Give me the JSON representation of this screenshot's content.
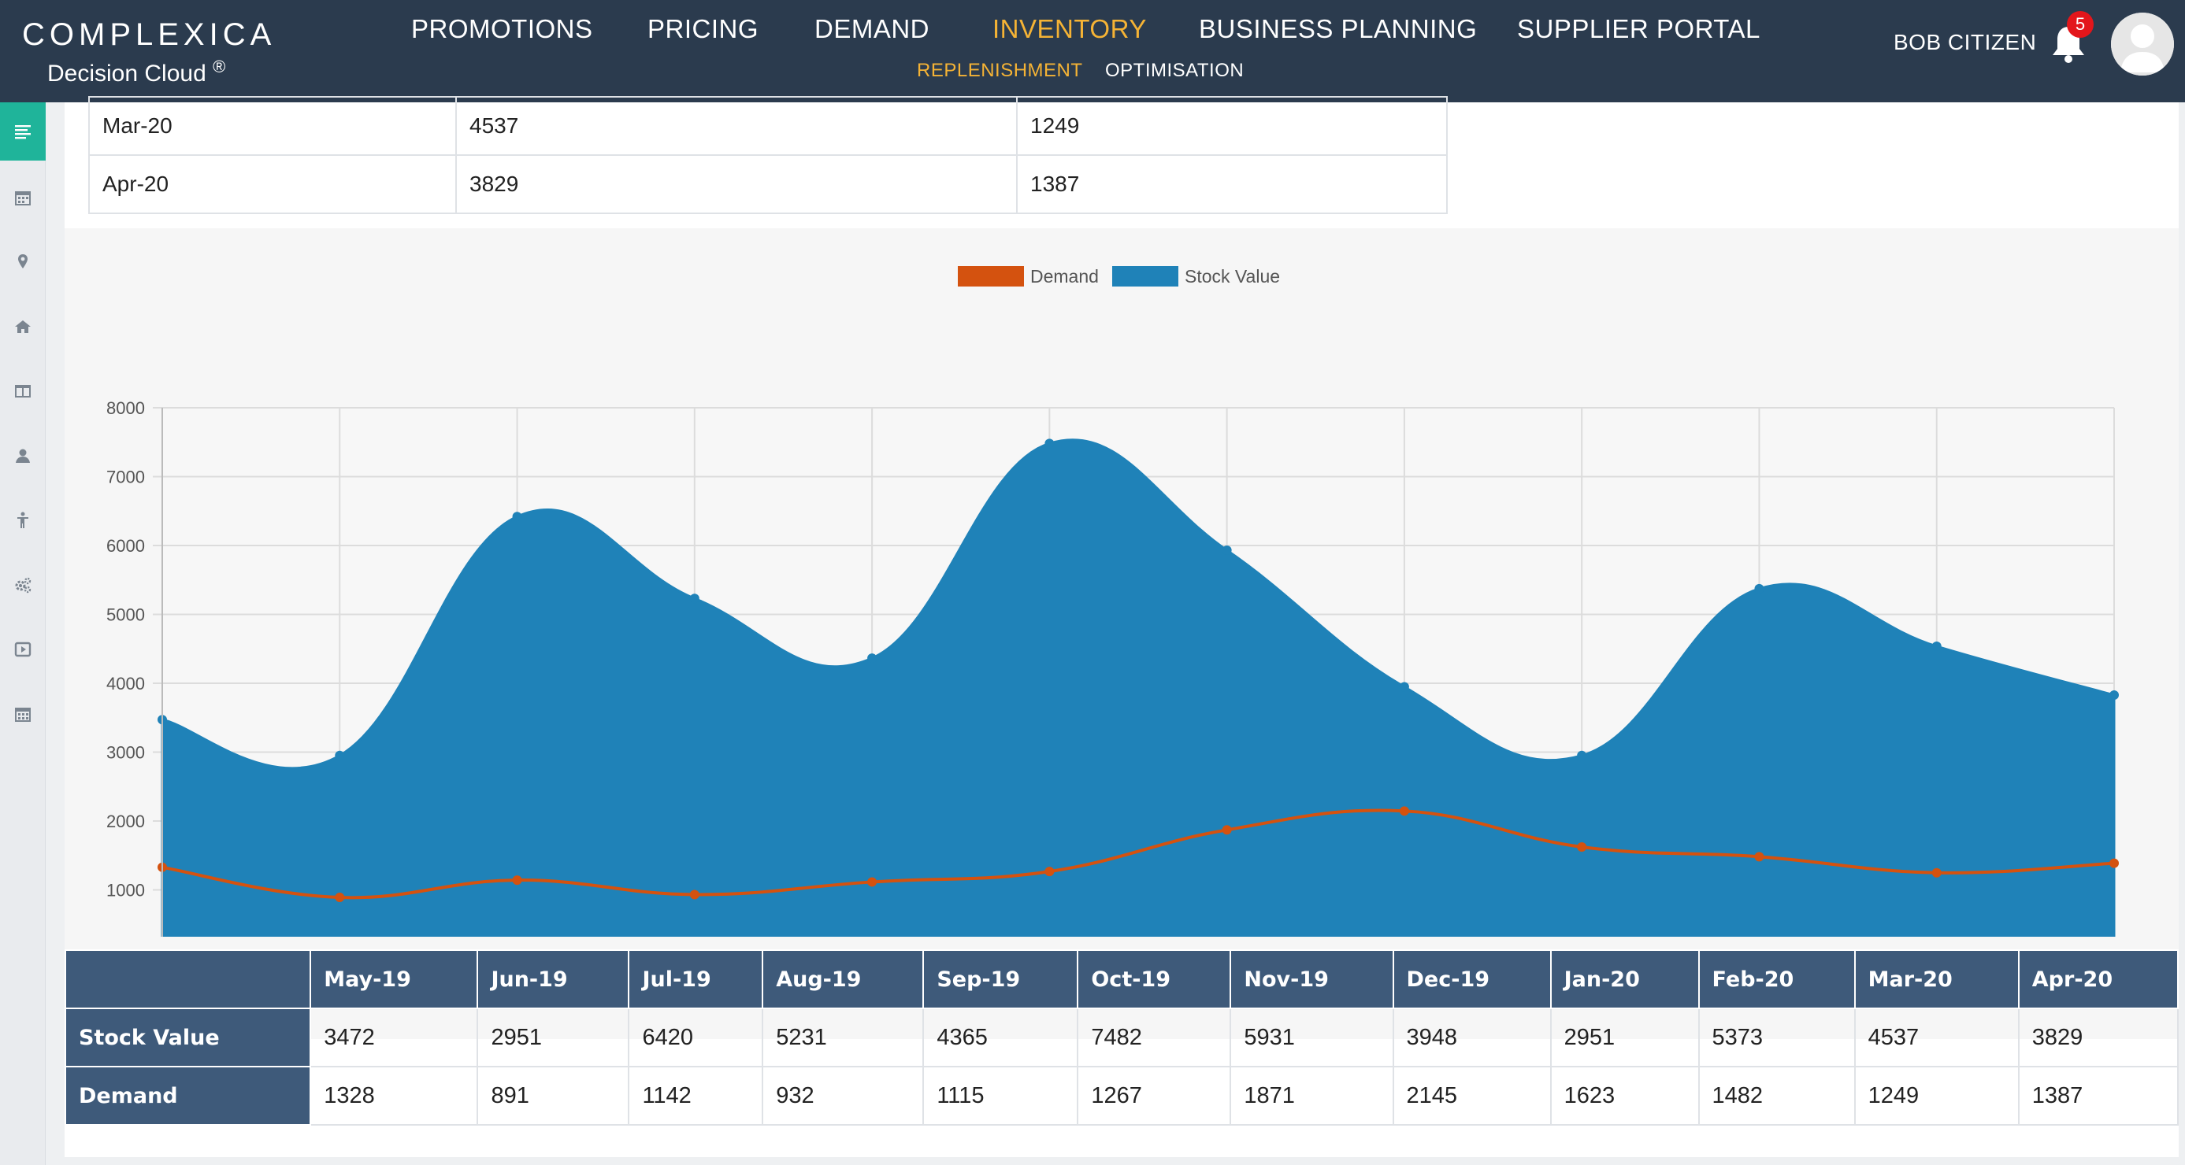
{
  "app": {
    "brand": "COMPLEXICA",
    "subtitle": "Decision Cloud",
    "registered": "®"
  },
  "nav": {
    "items": [
      {
        "label": "PROMOTIONS",
        "active": false
      },
      {
        "label": "PRICING",
        "active": false
      },
      {
        "label": "DEMAND",
        "active": false
      },
      {
        "label": "INVENTORY",
        "active": true
      },
      {
        "label": "BUSINESS PLANNING",
        "active": false
      },
      {
        "label": "SUPPLIER PORTAL",
        "active": false
      }
    ],
    "subitems": [
      {
        "label": "REPLENISHMENT",
        "active": true
      },
      {
        "label": "OPTIMISATION",
        "active": false
      }
    ]
  },
  "user": {
    "name": "BOB CITIZEN",
    "notification_count": "5"
  },
  "sidebar": {
    "items": [
      {
        "icon": "list-icon",
        "active": true
      },
      {
        "icon": "calendar-icon",
        "active": false
      },
      {
        "icon": "map-pin-icon",
        "active": false
      },
      {
        "icon": "home-icon",
        "active": false
      },
      {
        "icon": "columns-icon",
        "active": false
      },
      {
        "icon": "user-icon",
        "active": false
      },
      {
        "icon": "person-icon",
        "active": false
      },
      {
        "icon": "cogs-icon",
        "active": false
      },
      {
        "icon": "play-icon",
        "active": false
      },
      {
        "icon": "calendar-alt-icon",
        "active": false
      }
    ]
  },
  "monthly_table": {
    "rows": [
      [
        "Mar-20",
        "4537",
        "1249"
      ],
      [
        "Apr-20",
        "3829",
        "1387"
      ]
    ]
  },
  "colors": {
    "demand": "#d4520f",
    "stock_value": "#1f82b8",
    "header_bg": "#2b3b4e",
    "accent": "#f5b335",
    "sidebar_active": "#1fb49a",
    "table_header": "#3e5a7a"
  },
  "chart_data": {
    "type": "area",
    "categories": [
      "May-19",
      "Jun-19",
      "Jul-19",
      "Aug-19",
      "Sep-19",
      "Oct-19",
      "Nov-19",
      "Dec-19",
      "Jan-20",
      "Feb-20",
      "Mar-20",
      "Apr-20"
    ],
    "series": [
      {
        "name": "Demand",
        "type": "line",
        "values": [
          1328,
          891,
          1142,
          932,
          1115,
          1267,
          1871,
          2145,
          1623,
          1482,
          1249,
          1387
        ]
      },
      {
        "name": "Stock Value",
        "type": "area",
        "values": [
          3472,
          2951,
          6420,
          5231,
          4365,
          7482,
          5931,
          3948,
          2951,
          5373,
          4537,
          3829
        ]
      }
    ],
    "ylim": [
      0,
      8000
    ],
    "yticks": [
      "0",
      "1000",
      "2000",
      "3000",
      "4000",
      "5000",
      "6000",
      "7000",
      "8000"
    ],
    "grid": true,
    "legend": "top-center"
  },
  "summary_table": {
    "corner": "",
    "headers": [
      "May-19",
      "Jun-19",
      "Jul-19",
      "Aug-19",
      "Sep-19",
      "Oct-19",
      "Nov-19",
      "Dec-19",
      "Jan-20",
      "Feb-20",
      "Mar-20",
      "Apr-20"
    ],
    "rows": [
      {
        "label": "Stock Value",
        "values": [
          "3472",
          "2951",
          "6420",
          "5231",
          "4365",
          "7482",
          "5931",
          "3948",
          "2951",
          "5373",
          "4537",
          "3829"
        ]
      },
      {
        "label": "Demand",
        "values": [
          "1328",
          "891",
          "1142",
          "932",
          "1115",
          "1267",
          "1871",
          "2145",
          "1623",
          "1482",
          "1249",
          "1387"
        ]
      }
    ]
  }
}
